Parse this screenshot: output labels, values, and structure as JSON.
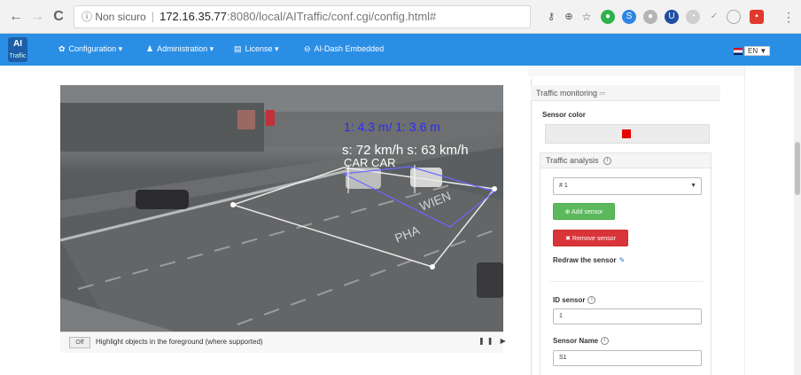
{
  "browser": {
    "back_icon": "←",
    "forward_icon": "→",
    "reload_icon": "C",
    "security_label": "ⓘ Non sicuro",
    "url_host": "172.16.35.77",
    "url_rest": ":8080/local/AITraffic/conf.cgi/config.html#",
    "menu_icon": "⋮"
  },
  "app": {
    "logo_text": "AI",
    "logo_sub": "Traffic",
    "menu": {
      "configuration": "Configuration",
      "administration": "Administration",
      "license": "License",
      "dash": "AI-Dash Embedded"
    },
    "language": "EN ▼"
  },
  "video": {
    "overlay_lines": [
      {
        "text": "1: 4.3 m/  1: 3.6 m",
        "color": "#2a2aff"
      },
      {
        "text": "s: 72 km/h s: 63 km/h",
        "color": "#ffffff"
      },
      {
        "text": "CAR     CAR",
        "color": "#ffffff"
      }
    ],
    "road_text": [
      "WIEN",
      "PHA"
    ]
  },
  "highlight": {
    "toggle_label": "Off",
    "text": "Highlight objects in the foreground (where supported)",
    "play_controls": "❚❚ ▶"
  },
  "panel": {
    "title": "Traffic monitoring",
    "sensor_color_label": "Sensor color",
    "sensor_color": "#e60000",
    "analysis_title": "Traffic analysis",
    "selected_sensor": "# 1",
    "add_sensor": "⊕ Add sensor",
    "remove_sensor": "✖ Remove sensor",
    "redraw_label": "Redraw the sensor",
    "id_label": "ID sensor",
    "id_value": "1",
    "name_label": "Sensor Name",
    "name_value": "S1"
  },
  "colors": {
    "accent": "#2a8ee5",
    "add_button": "#5cb85c",
    "remove_button": "#d9343a"
  }
}
